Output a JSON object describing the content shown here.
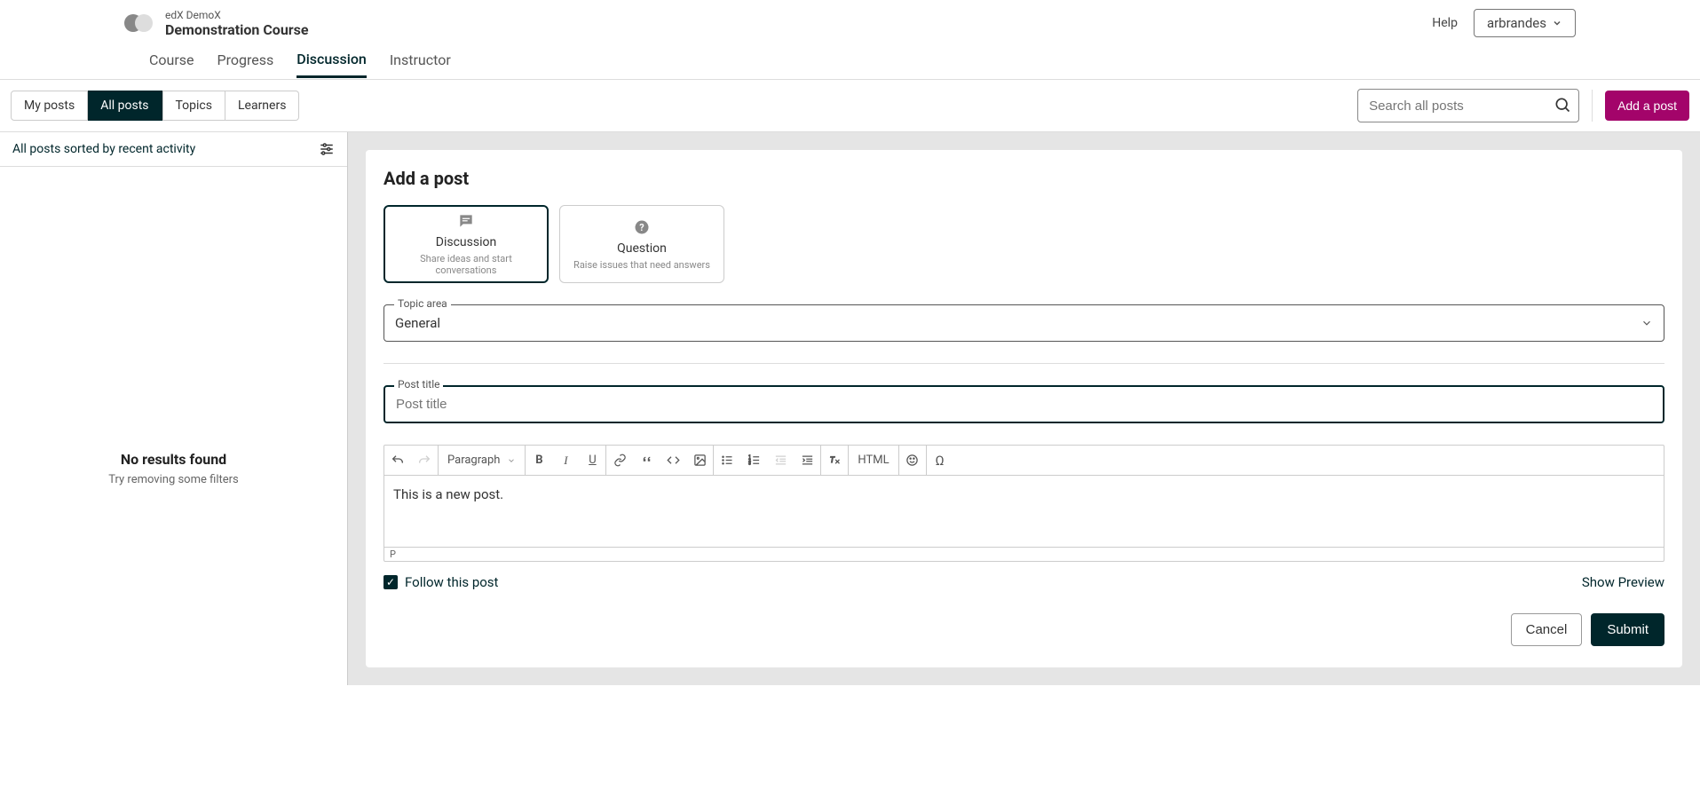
{
  "header": {
    "org": "edX DemoX",
    "course": "Demonstration Course",
    "help": "Help",
    "user": "arbrandes"
  },
  "nav": {
    "course": "Course",
    "progress": "Progress",
    "discussion": "Discussion",
    "instructor": "Instructor"
  },
  "toolbar": {
    "my_posts": "My posts",
    "all_posts": "All posts",
    "topics": "Topics",
    "learners": "Learners",
    "search_placeholder": "Search all posts",
    "add_post": "Add a post"
  },
  "sidebar": {
    "sort_text": "All posts sorted by recent activity",
    "no_results_title": "No results found",
    "no_results_sub": "Try removing some filters"
  },
  "form": {
    "title": "Add a post",
    "type_discussion_title": "Discussion",
    "type_discussion_sub": "Share ideas and start conversations",
    "type_question_title": "Question",
    "type_question_sub": "Raise issues that need answers",
    "topic_label": "Topic area",
    "topic_value": "General",
    "post_title_label": "Post title",
    "post_title_placeholder": "Post title",
    "body_text": "This is a new post.",
    "paragraph": "Paragraph",
    "html_btn": "HTML",
    "path": "P",
    "follow": "Follow this post",
    "preview": "Show Preview",
    "cancel": "Cancel",
    "submit": "Submit"
  }
}
